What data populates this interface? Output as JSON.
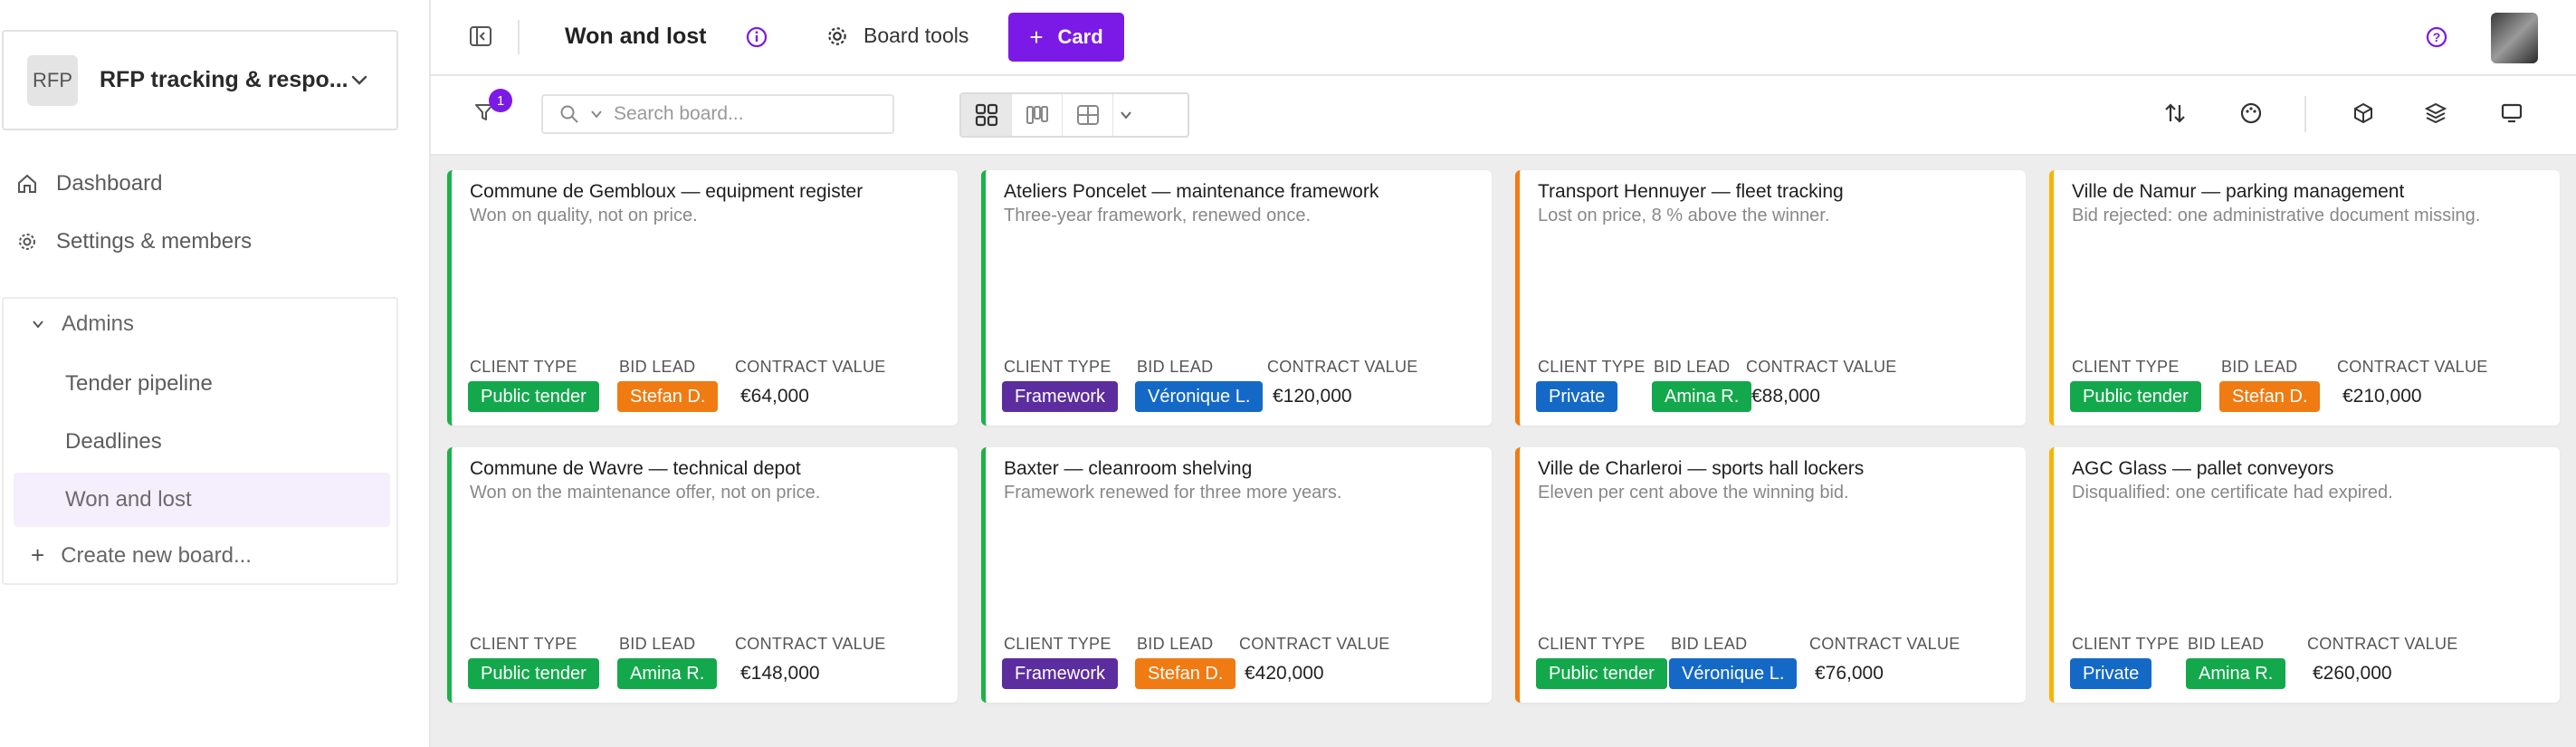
{
  "workspace": {
    "logo_text": "RFP",
    "name": "RFP tracking & respo..."
  },
  "nav": {
    "dashboard": "Dashboard",
    "settings": "Settings & members"
  },
  "group": {
    "label": "Admins",
    "items": [
      "Tender pipeline",
      "Deadlines",
      "Won and lost"
    ],
    "active_index": 2,
    "create": "Create new board..."
  },
  "header": {
    "board_title": "Won and lost",
    "board_tools": "Board tools",
    "card_button": "Card"
  },
  "toolbar": {
    "filter_count": "1",
    "search_placeholder": "Search board..."
  },
  "colors": {
    "accent": "#7b1ae6",
    "won": "#1db14a",
    "lost": "#f07b12",
    "rejected": "#f7b500",
    "tag_green": "#14a84c",
    "tag_orange": "#f07b12",
    "tag_purple": "#5b2d9e",
    "tag_blue": "#1469c7"
  },
  "field_labels": {
    "client_type": "CLIENT TYPE",
    "bid_lead": "BID LEAD",
    "contract_value": "CONTRACT VALUE"
  },
  "cards": [
    {
      "title": "Commune de Gembloux — equipment register",
      "desc": "Won on quality, not on price.",
      "client_type": "Public tender",
      "bid_lead": "Stefan D.",
      "value": "€64,000"
    },
    {
      "title": "Ateliers Poncelet — maintenance framework",
      "desc": "Three-year framework, renewed once.",
      "client_type": "Framework",
      "bid_lead": "Véronique L.",
      "value": "€120,000"
    },
    {
      "title": "Transport Hennuyer — fleet tracking",
      "desc": "Lost on price, 8 % above the winner.",
      "client_type": "Private",
      "bid_lead": "Amina R.",
      "value": "€88,000"
    },
    {
      "title": "Ville de Namur — parking management",
      "desc": "Bid rejected: one administrative document missing.",
      "client_type": "Public tender",
      "bid_lead": "Stefan D.",
      "value": "€210,000"
    },
    {
      "title": "Commune de Wavre — technical depot",
      "desc": "Won on the maintenance offer, not on price.",
      "client_type": "Public tender",
      "bid_lead": "Amina R.",
      "value": "€148,000"
    },
    {
      "title": "Baxter — cleanroom shelving",
      "desc": "Framework renewed for three more years.",
      "client_type": "Framework",
      "bid_lead": "Stefan D.",
      "value": "€420,000"
    },
    {
      "title": "Ville de Charleroi — sports hall lockers",
      "desc": "Eleven per cent above the winning bid.",
      "client_type": "Public tender",
      "bid_lead": "Véronique L.",
      "value": "€76,000"
    },
    {
      "title": "AGC Glass — pallet conveyors",
      "desc": "Disqualified: one certificate had expired.",
      "client_type": "Private",
      "bid_lead": "Amina R.",
      "value": "€260,000"
    }
  ]
}
